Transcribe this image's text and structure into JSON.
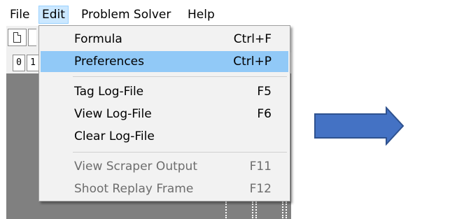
{
  "menubar": {
    "items": [
      {
        "label": "File"
      },
      {
        "label": "Edit"
      },
      {
        "label": "Problem Solver"
      },
      {
        "label": "Help"
      }
    ]
  },
  "toolbar": {
    "number_buttons": [
      "0",
      "1"
    ]
  },
  "edit_menu": {
    "items": [
      {
        "label": "Formula",
        "shortcut": "Ctrl+F"
      },
      {
        "label": "Preferences",
        "shortcut": "Ctrl+P"
      },
      {
        "label": "Tag Log-File",
        "shortcut": "F5"
      },
      {
        "label": "View Log-File",
        "shortcut": "F6"
      },
      {
        "label": "Clear Log-File",
        "shortcut": ""
      },
      {
        "label": "View Scraper Output",
        "shortcut": "F11"
      },
      {
        "label": "Shoot Replay Frame",
        "shortcut": "F12"
      }
    ],
    "highlighted_item": "Preferences",
    "disabled_items": [
      "View Scraper Output",
      "Shoot Replay Frame"
    ]
  },
  "colors": {
    "highlight": "#91c9f7",
    "menu_background": "#f2f2f2",
    "active_menu": "#cce8ff",
    "canvas": "#808080",
    "arrow_fill": "#4472c4",
    "arrow_stroke": "#2f528f"
  },
  "icons": [
    "new-document-icon",
    "right-arrow-icon"
  ]
}
